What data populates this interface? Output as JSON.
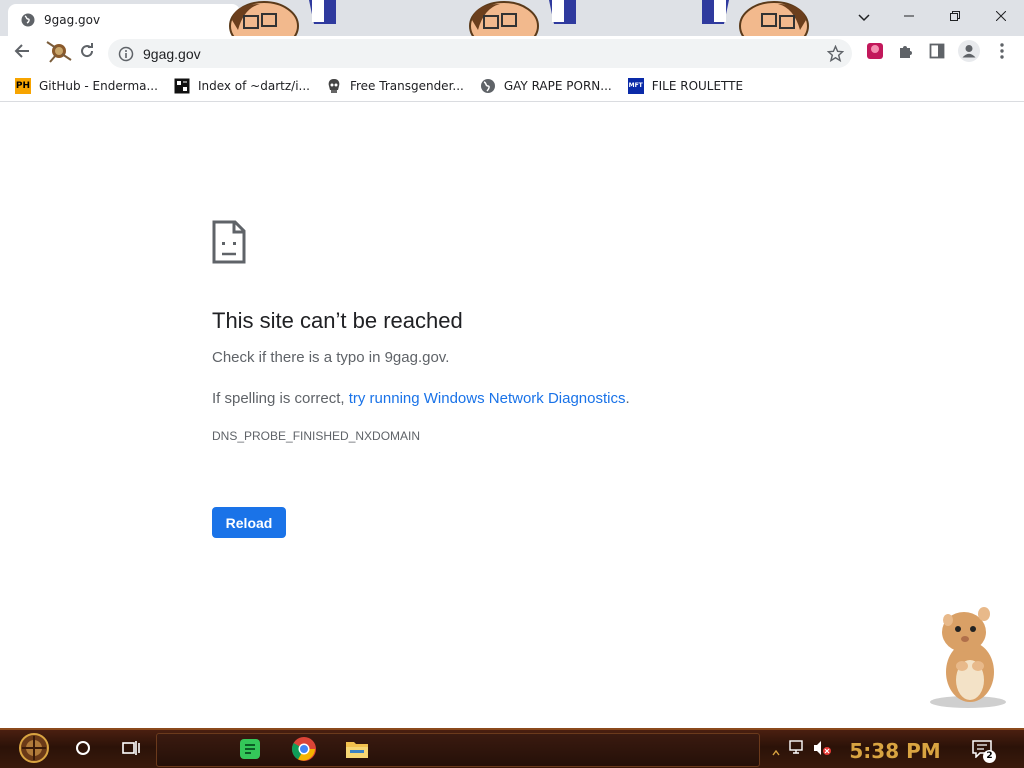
{
  "tab": {
    "title": "9gag.gov",
    "close_icon": "close-icon"
  },
  "window_controls": {
    "tab_search": "chevron-down-icon",
    "minimize": "minimize-icon",
    "restore": "restore-icon",
    "close": "close-icon"
  },
  "toolbar": {
    "url": "9gag.gov"
  },
  "bookmarks": [
    {
      "label": "GitHub - Enderma...",
      "icon": "PH"
    },
    {
      "label": "Index of ~dartz/i...",
      "icon": "index-icon"
    },
    {
      "label": "Free Transgender...",
      "icon": "skull-icon"
    },
    {
      "label": "GAY RAPE PORN...",
      "icon": "globe-icon"
    },
    {
      "label": "FILE ROULETTE",
      "icon": "MFT"
    }
  ],
  "error": {
    "title": "This site can’t be reached",
    "line1": "Check if there is a typo in 9gag.gov.",
    "line2_prefix": "If spelling is correct, ",
    "line2_link": "try running Windows Network Diagnostics",
    "line2_suffix": ".",
    "code": "DNS_PROBE_FINISHED_NXDOMAIN",
    "reload_label": "Reload"
  },
  "taskbar": {
    "clock": "5:38 PM",
    "notification_count": "2"
  },
  "colors": {
    "accent": "#1a73e8",
    "tabstrip": "#dee1e6",
    "clock": "#d9a441",
    "taskbar": "#2b1208"
  }
}
